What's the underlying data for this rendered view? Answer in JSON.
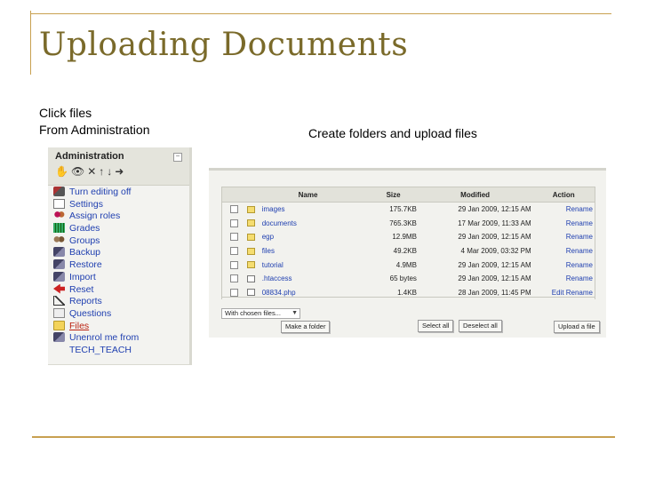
{
  "slide": {
    "title": "Uploading Documents",
    "caption_left_line1": "Click files",
    "caption_left_line2": "From Administration",
    "caption_right": "Create folders and upload files"
  },
  "admin_block": {
    "title": "Administration",
    "collapse_label": "−",
    "tools": [
      "✋",
      "👁",
      "✕",
      "↑",
      "↓",
      "➜"
    ],
    "items": [
      {
        "label": "Turn editing off",
        "icon": "edit-icon"
      },
      {
        "label": "Settings",
        "icon": "settings-icon"
      },
      {
        "label": "Assign roles",
        "icon": "roles-icon"
      },
      {
        "label": "Grades",
        "icon": "grades-icon"
      },
      {
        "label": "Groups",
        "icon": "groups-icon"
      },
      {
        "label": "Backup",
        "icon": "backup-icon"
      },
      {
        "label": "Restore",
        "icon": "restore-icon"
      },
      {
        "label": "Import",
        "icon": "import-icon"
      },
      {
        "label": "Reset",
        "icon": "reset-icon"
      },
      {
        "label": "Reports",
        "icon": "reports-icon"
      },
      {
        "label": "Questions",
        "icon": "questions-icon"
      },
      {
        "label": "Files",
        "icon": "folder-icon"
      },
      {
        "label": "Unenrol me from",
        "icon": "unenrol-icon"
      },
      {
        "label": "TECH_TEACH",
        "icon": ""
      }
    ]
  },
  "file_manager": {
    "columns": [
      "Name",
      "Size",
      "Modified",
      "Action"
    ],
    "rows": [
      {
        "name": "images",
        "type": "folder",
        "size": "175.7KB",
        "modified": "29 Jan 2009, 12:15 AM",
        "action": "Rename"
      },
      {
        "name": "documents",
        "type": "folder",
        "size": "765.3KB",
        "modified": "17 Mar 2009, 11:33 AM",
        "action": "Rename"
      },
      {
        "name": "egp",
        "type": "folder",
        "size": "12.9MB",
        "modified": "29 Jan 2009, 12:15 AM",
        "action": "Rename"
      },
      {
        "name": "files",
        "type": "folder",
        "size": "49.2KB",
        "modified": "4 Mar 2009, 03:32 PM",
        "action": "Rename"
      },
      {
        "name": "tutorial",
        "type": "folder",
        "size": "4.9MB",
        "modified": "29 Jan 2009, 12:15 AM",
        "action": "Rename"
      },
      {
        "name": ".htaccess",
        "type": "file",
        "size": "65 bytes",
        "modified": "29 Jan 2009, 12:15 AM",
        "action": "Rename"
      },
      {
        "name": "08834.php",
        "type": "file",
        "size": "1.4KB",
        "modified": "28 Jan 2009, 11:45 PM",
        "action": "Edit Rename"
      }
    ],
    "with_chosen": "With chosen files...",
    "make_folder": "Make a folder",
    "select_all": "Select all",
    "deselect_all": "Deselect all",
    "upload_file": "Upload a file"
  }
}
